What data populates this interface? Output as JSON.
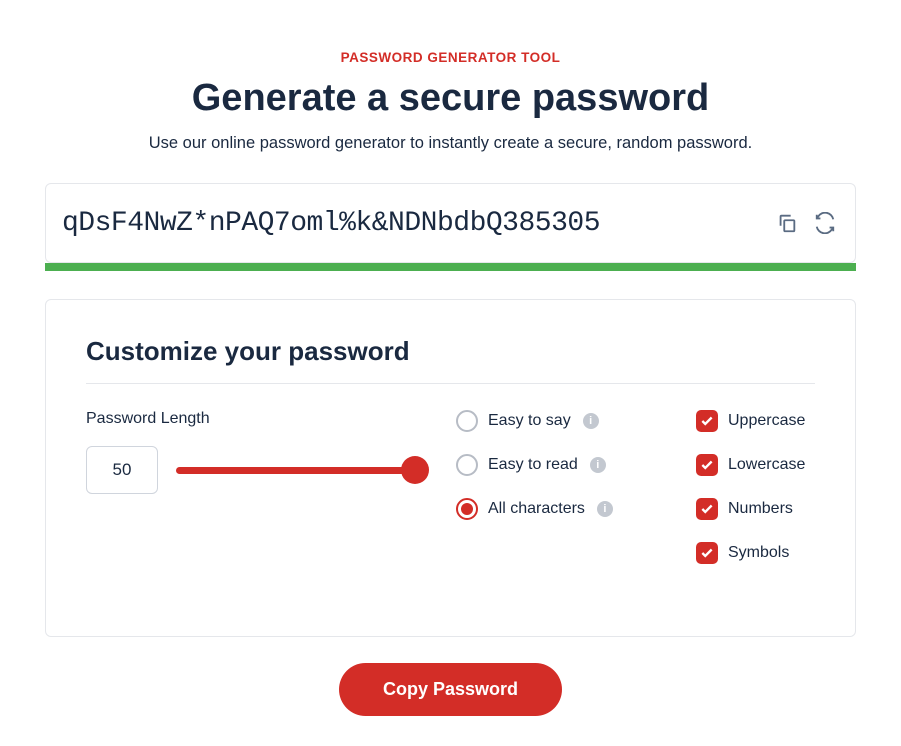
{
  "eyebrow": "PASSWORD GENERATOR TOOL",
  "title": "Generate a secure password",
  "subtitle": "Use our online password generator to instantly create a secure, random password.",
  "password": "qDsF4NwZ*nPAQ7oml%k&NDNbdbQ385305",
  "customize": {
    "heading": "Customize your password",
    "length_label": "Password Length",
    "length_value": "50",
    "type_options": {
      "easy_say": "Easy to say",
      "easy_read": "Easy to read",
      "all_chars": "All characters",
      "selected": "all_chars"
    },
    "char_options": {
      "uppercase": "Uppercase",
      "lowercase": "Lowercase",
      "numbers": "Numbers",
      "symbols": "Symbols"
    }
  },
  "copy_button": "Copy Password"
}
